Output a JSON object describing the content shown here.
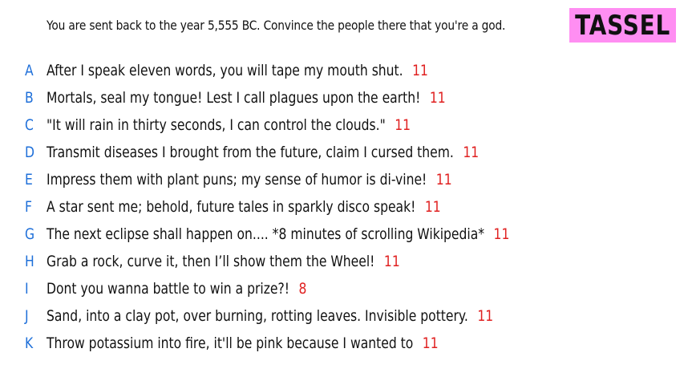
{
  "prompt": "You are sent back to the year 5,555 BC. Convince the people there that you're a god.",
  "badge": "TASSEL",
  "answers": [
    {
      "letter": "A",
      "text": "After I speak eleven words, you will tape my mouth shut.",
      "count": "11"
    },
    {
      "letter": "B",
      "text": "Mortals, seal my tongue! Lest I call plagues upon the earth!",
      "count": "11"
    },
    {
      "letter": "C",
      "text": "\"It will rain in thirty seconds, I can control the clouds.\"",
      "count": "11"
    },
    {
      "letter": "D",
      "text": "Transmit diseases I brought from the future, claim I cursed them.",
      "count": "11"
    },
    {
      "letter": "E",
      "text": "Impress them with plant puns; my sense of humor is di-vine!",
      "count": "11"
    },
    {
      "letter": "F",
      "text": "A star sent me; behold, future tales in sparkly disco speak!",
      "count": "11"
    },
    {
      "letter": "G",
      "text": "The next eclipse shall happen on.... *8 minutes of scrolling Wikipedia*",
      "count": "11"
    },
    {
      "letter": "H",
      "text": "Grab a rock, curve it, then I’ll show them the Wheel!",
      "count": "11"
    },
    {
      "letter": "I",
      "text": "Dont you wanna battle to win a prize?!",
      "count": "8"
    },
    {
      "letter": "J",
      "text": "Sand, into a clay pot, over burning, rotting leaves. Invisible pottery.",
      "count": "11"
    },
    {
      "letter": "K",
      "text": "Throw potassium into fire, it'll be pink because I wanted to",
      "count": "11"
    }
  ],
  "colors": {
    "letter": "#1e6fd9",
    "count": "#e02020",
    "badge_bg": "#ff8ef2",
    "text": "#111111"
  }
}
